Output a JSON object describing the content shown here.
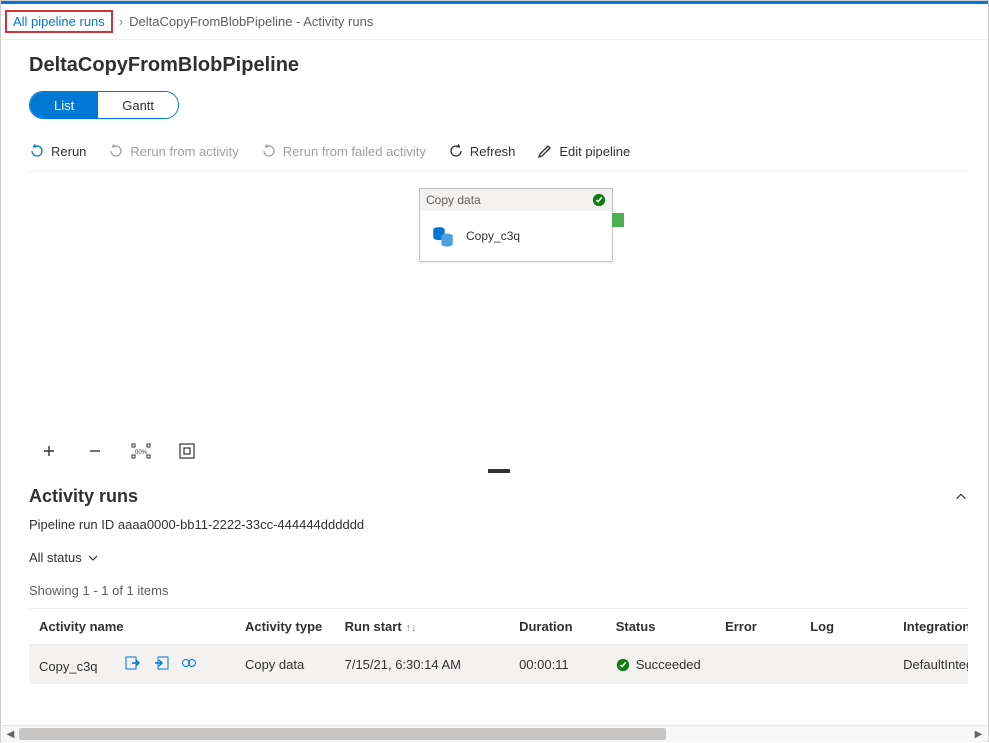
{
  "breadcrumb": {
    "all_runs": "All pipeline runs",
    "current": "DeltaCopyFromBlobPipeline - Activity runs"
  },
  "page_title": "DeltaCopyFromBlobPipeline",
  "view_toggle": {
    "list": "List",
    "gantt": "Gantt"
  },
  "toolbar": {
    "rerun": "Rerun",
    "rerun_from_activity": "Rerun from activity",
    "rerun_from_failed": "Rerun from failed activity",
    "refresh": "Refresh",
    "edit_pipeline": "Edit pipeline"
  },
  "card": {
    "header": "Copy data",
    "title": "Copy_c3q"
  },
  "zoom": {
    "fit_label": "100%"
  },
  "activity_runs": {
    "title": "Activity runs",
    "pipeline_id_label": "Pipeline run ID",
    "pipeline_id_value": "aaaa0000-bb11-2222-33cc-444444dddddd",
    "status_filter": "All status",
    "showing": "Showing 1 - 1 of 1 items",
    "columns": {
      "activity_name": "Activity name",
      "activity_type": "Activity type",
      "run_start": "Run start",
      "duration": "Duration",
      "status": "Status",
      "error": "Error",
      "log": "Log",
      "integration": "Integration r"
    },
    "rows": [
      {
        "activity_name": "Copy_c3q",
        "activity_type": "Copy data",
        "run_start": "7/15/21, 6:30:14 AM",
        "duration": "00:00:11",
        "status": "Succeeded",
        "error": "",
        "log": "",
        "integration": "DefaultIntegr"
      }
    ]
  }
}
